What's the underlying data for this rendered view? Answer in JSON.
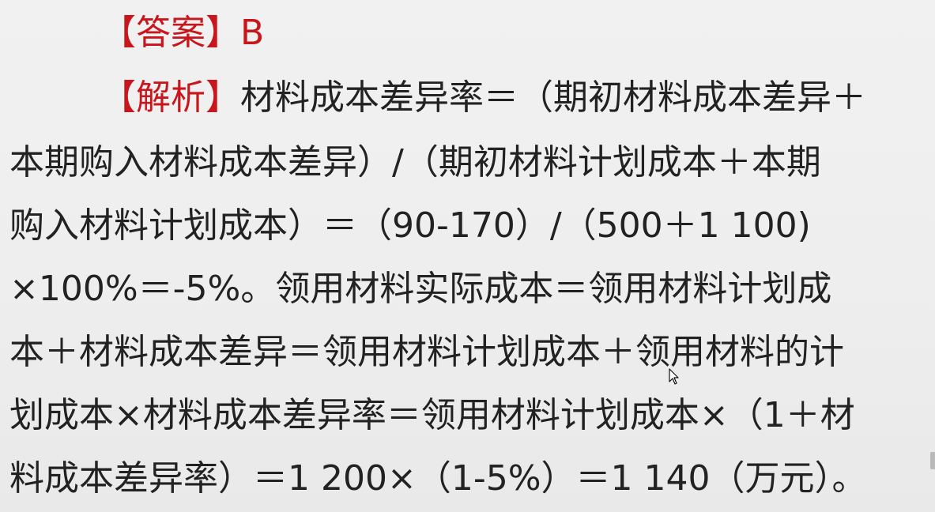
{
  "answer": {
    "label": "【答案】",
    "value": "B"
  },
  "analysis": {
    "label": "【解析】",
    "lines": [
      "材料成本差异率＝（期初材料成本差异＋",
      "本期购入材料成本差异）/（期初材料计划成本＋本期",
      "购入材料计划成本）＝（90-170）/（500＋1 100)",
      "×100%＝-5%。领用材料实际成本＝领用材料计划成",
      "本＋材料成本差异＝领用材料计划成本＋领用材料的计",
      "划成本×材料成本差异率＝领用材料计划成本×（1＋材",
      "料成本差异率）＝1 200×（1-5%）＝1 140（万元）。"
    ]
  },
  "icons": {
    "cursor": "mouse-pointer-icon"
  },
  "colors": {
    "accent_red": "#c8161d",
    "text": "#222222",
    "background": "#eeeeee"
  }
}
